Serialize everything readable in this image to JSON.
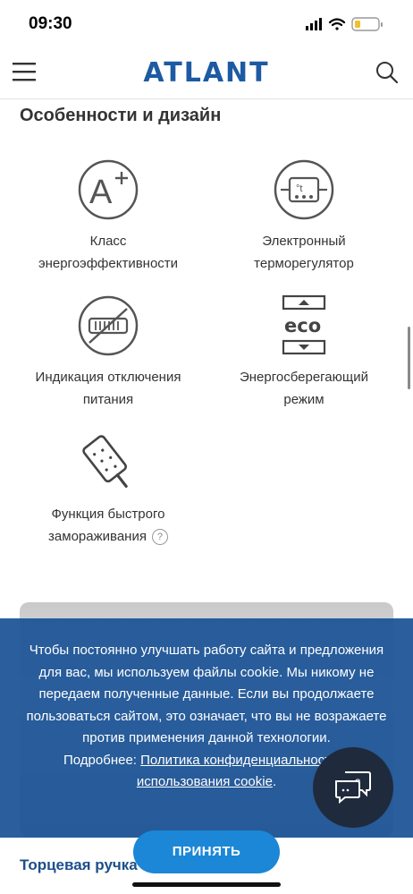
{
  "status_bar": {
    "time": "09:30"
  },
  "header": {
    "logo": "ATLANT"
  },
  "section_title": "Особенности и дизайн",
  "features": [
    {
      "label_line1": "Класс",
      "label_line2": "энергоэффективности",
      "icon": "energy-class-a-plus-icon",
      "icon_text": "A"
    },
    {
      "label_line1": "Электронный",
      "label_line2": "терморегулятор",
      "icon": "electronic-thermostat-icon",
      "icon_text": "°t"
    },
    {
      "label_line1": "Индикация отключения",
      "label_line2": "питания",
      "icon": "power-off-indicator-icon"
    },
    {
      "label_line1": "Энергосберегающий",
      "label_line2": "режим",
      "icon": "eco-mode-icon",
      "icon_text": "eco"
    },
    {
      "label_line1": "Функция быстрого",
      "label_line2": "замораживания",
      "icon": "fast-freeze-icon",
      "help": "?"
    }
  ],
  "cookie_banner": {
    "text": "Чтобы постоянно улучшать работу сайта и предложения для вас, мы используем файлы cookie. Мы никому не передаем полученные данные. Если вы продолжаете пользоваться сайтом, это означает, что вы не возражаете против применения данной технологии.",
    "more_label": "Подробнее: ",
    "link_text": "Политика конфиденциальности и использования cookie",
    "period": ".",
    "accept_label": "ПРИНЯТЬ"
  },
  "background_heading": "Торцевая ручка",
  "colors": {
    "brand": "#1d5aa3",
    "banner": "#1d5496",
    "accept": "#1b87d6",
    "chat": "#1f2a3c"
  }
}
